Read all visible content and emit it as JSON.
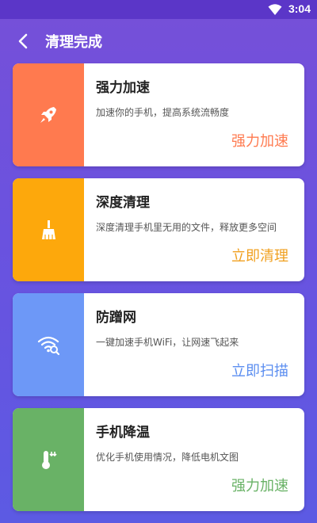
{
  "status_bar": {
    "time": "3:04",
    "wifi_icon": "wifi-icon"
  },
  "header": {
    "title": "清理完成",
    "back_icon": "chevron-left-icon"
  },
  "cards": [
    {
      "title": "强力加速",
      "desc": "加速你的手机，提高系统流畅度",
      "action": "强力加速",
      "icon": "rocket-icon",
      "color": "#ff7a4f"
    },
    {
      "title": "深度清理",
      "desc": "深度清理手机里无用的文件，释放更多空间",
      "action": "立即清理",
      "icon": "broom-icon",
      "color": "#fda80c"
    },
    {
      "title": "防蹭网",
      "desc": "一键加速手机WiFi，让网速飞起来",
      "action": "立即扫描",
      "icon": "wifi-shield-icon",
      "color": "#6d98f7"
    },
    {
      "title": "手机降温",
      "desc": "优化手机使用情况，降低电机文图",
      "action": "强力加速",
      "icon": "thermometer-icon",
      "color": "#69b266"
    }
  ]
}
